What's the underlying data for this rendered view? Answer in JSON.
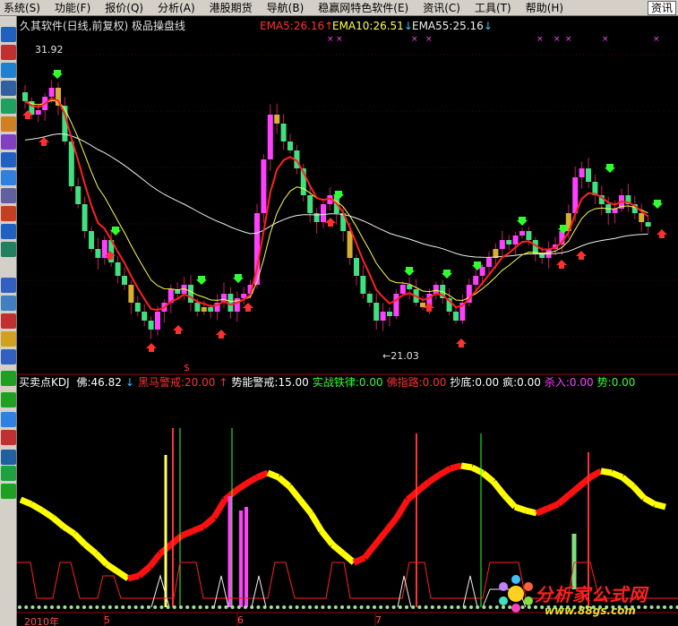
{
  "menu": {
    "items": [
      "系统(S)",
      "功能(F)",
      "报价(Q)",
      "分析(A)",
      "港股期货",
      "导航(B)",
      "稳赢网特色软件(E)",
      "资讯(C)",
      "工具(T)",
      "帮助(H)"
    ],
    "right_label": "资讯"
  },
  "main_chart": {
    "title": "久其软件(日线,前复权)",
    "indicator_name": "极品操盘线",
    "ema5": "EMA5:26.16",
    "ema10": "EMA10:26.51",
    "ema55": "EMA55:25.16",
    "ema5_arrow": "↑",
    "ema10_arrow": "↓",
    "ema55_arrow": "↓",
    "high_label": "31.92",
    "low_label": "←21.03",
    "dollar_mark": "$"
  },
  "indicator_panel": {
    "name": "买卖点KDJ",
    "fields": [
      {
        "text": "佛:46.82",
        "color": "#ffffff"
      },
      {
        "text": "↓",
        "color": "#30c0ff"
      },
      {
        "text": "黑马警戒:20.00",
        "color": "#ff3030"
      },
      {
        "text": "↑",
        "color": "#ff3030"
      },
      {
        "text": "势能警戒:15.00",
        "color": "#ffffff"
      },
      {
        "text": "实战铁律:0.00",
        "color": "#30ff30"
      },
      {
        "text": "佛指路:0.00",
        "color": "#ff3030"
      },
      {
        "text": "抄底:0.00",
        "color": "#ffffff"
      },
      {
        "text": "疯:0.00",
        "color": "#ffffff"
      },
      {
        "text": "杀入:0.00",
        "color": "#ff40ff"
      },
      {
        "text": "势:0.00",
        "color": "#30ff30"
      }
    ]
  },
  "date_axis": [
    "2010年",
    "5",
    "6",
    "7"
  ],
  "logo": {
    "title": "分析家公式网",
    "url": "www.88gs.com"
  },
  "colors": {
    "up_candle": "#ff40ff",
    "down_candle": "#40e080",
    "neutral_candle": "#d8b030",
    "ema5": "#ff2020",
    "ema10": "#ffff40",
    "ema55": "#f0f0f0"
  }
}
